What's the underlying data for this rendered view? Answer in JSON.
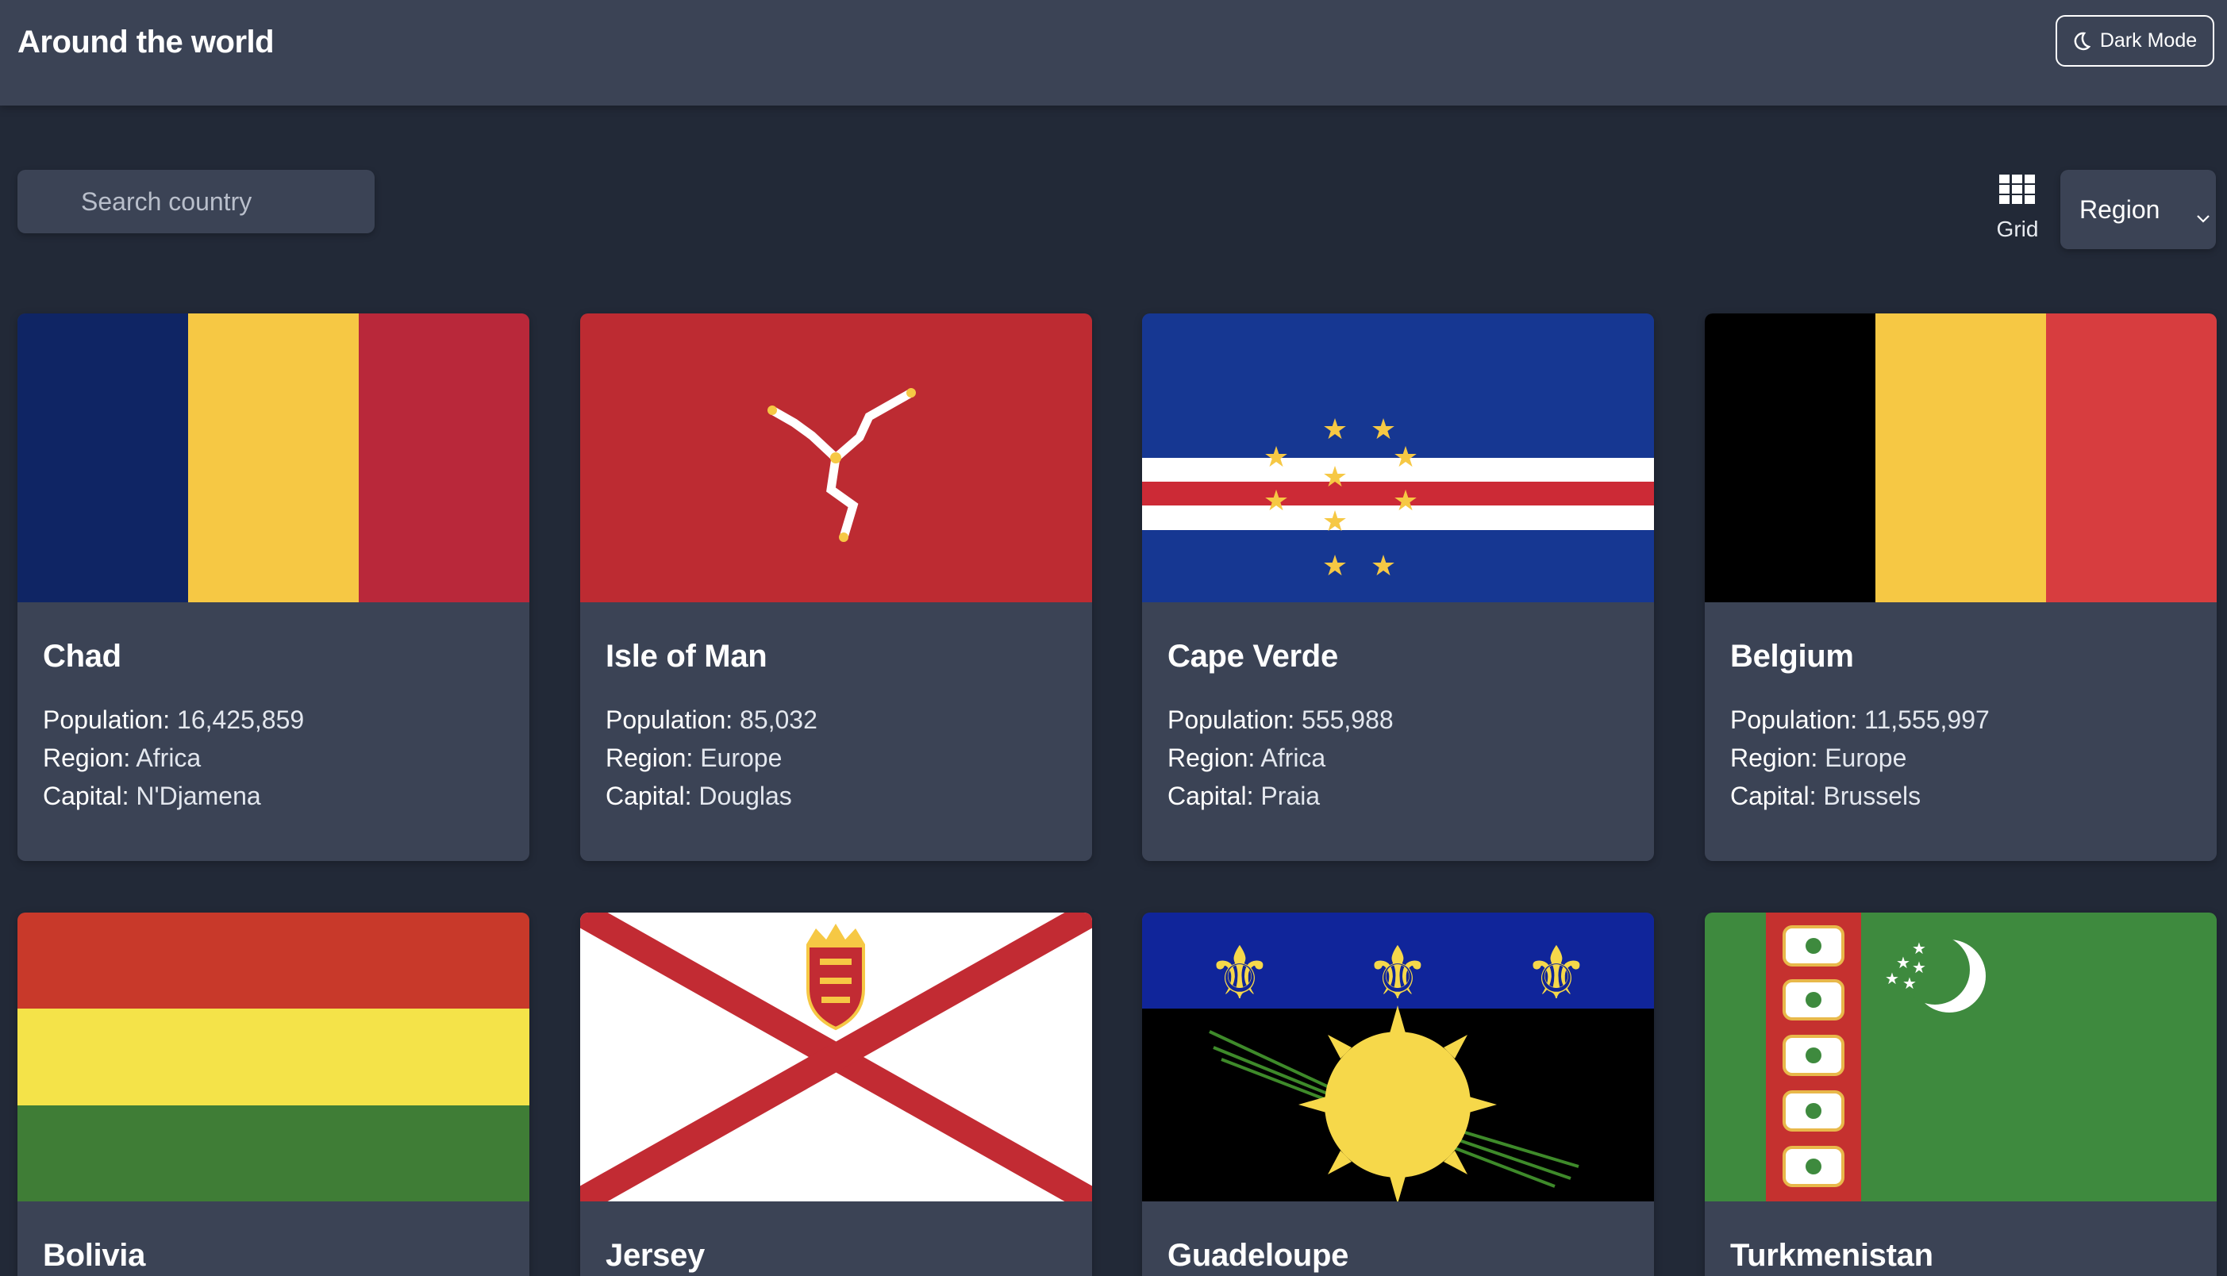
{
  "header": {
    "title": "Around the world",
    "dark_mode_label": "Dark Mode"
  },
  "controls": {
    "search_placeholder": "Search country",
    "search_value": "",
    "view_toggle_label": "Grid",
    "region_select_label": "Region"
  },
  "labels": {
    "population": "Population:",
    "region": "Region:",
    "capital": "Capital:"
  },
  "countries": [
    {
      "name": "Chad",
      "population": "16,425,859",
      "region": "Africa",
      "capital": "N'Djamena",
      "flag_icon": "flag-chad-icon"
    },
    {
      "name": "Isle of Man",
      "population": "85,032",
      "region": "Europe",
      "capital": "Douglas",
      "flag_icon": "flag-isle-of-man-icon"
    },
    {
      "name": "Cape Verde",
      "population": "555,988",
      "region": "Africa",
      "capital": "Praia",
      "flag_icon": "flag-cape-verde-icon"
    },
    {
      "name": "Belgium",
      "population": "11,555,997",
      "region": "Europe",
      "capital": "Brussels",
      "flag_icon": "flag-belgium-icon"
    },
    {
      "name": "Bolivia",
      "flag_icon": "flag-bolivia-icon"
    },
    {
      "name": "Jersey",
      "flag_icon": "flag-jersey-icon"
    },
    {
      "name": "Guadeloupe",
      "flag_icon": "flag-guadeloupe-icon"
    },
    {
      "name": "Turkmenistan",
      "flag_icon": "flag-turkmenistan-icon"
    }
  ],
  "colors": {
    "background": "#222937",
    "surface": "#3b4355",
    "text": "#ffffff"
  }
}
